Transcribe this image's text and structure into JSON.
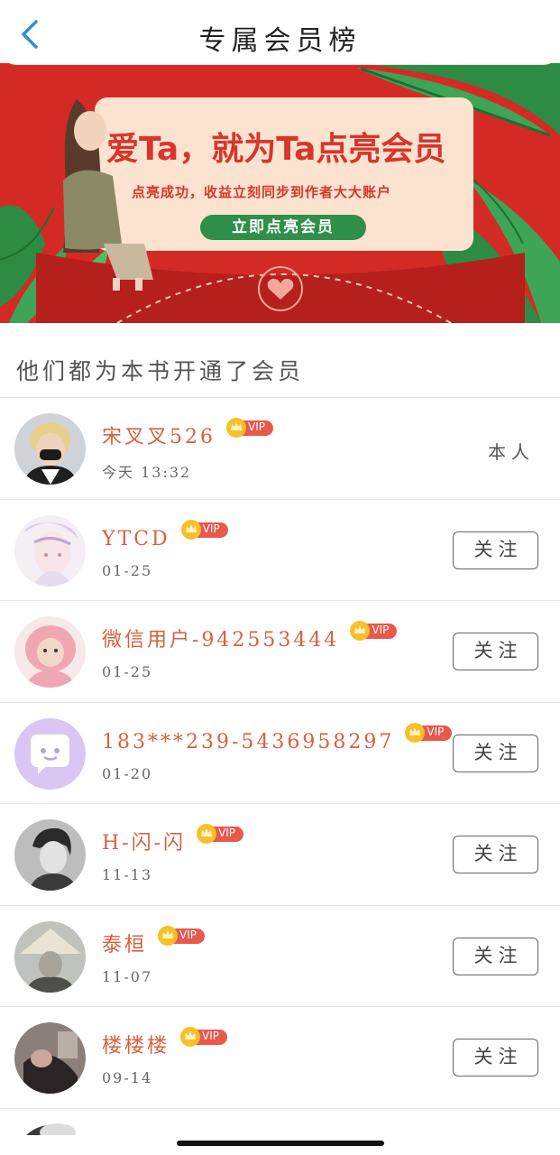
{
  "header": {
    "title": "专属会员榜",
    "back_icon": "chevron-left-icon"
  },
  "banner": {
    "headline": "爱Ta，就为Ta点亮会员",
    "subline": "点亮成功，收益立刻同步到作者大大账户",
    "cta": "立即点亮会员",
    "bg_color": "#d42a26",
    "cta_color": "#2e8f4a"
  },
  "section": {
    "title": "他们都为本书开通了会员"
  },
  "vip_badge": "VIP",
  "members": [
    {
      "name": "宋叉叉526",
      "date": "今天 13:32",
      "action": "本人",
      "is_self": true
    },
    {
      "name": "YTCD",
      "date": "01-25",
      "action": "关注"
    },
    {
      "name": "微信用户-942553444",
      "date": "01-25",
      "action": "关注"
    },
    {
      "name": "183***239-5436958297",
      "date": "01-20",
      "action": "关注"
    },
    {
      "name": "H-闪-闪",
      "date": "11-13",
      "action": "关注"
    },
    {
      "name": "泰桓",
      "date": "11-07",
      "action": "关注"
    },
    {
      "name": "楼楼楼",
      "date": "09-14",
      "action": "关注"
    }
  ],
  "colors": {
    "name": "#d9603e",
    "vip_badge": "#e8584b",
    "crown": "#f5c02a",
    "back": "#2d8ee0"
  }
}
